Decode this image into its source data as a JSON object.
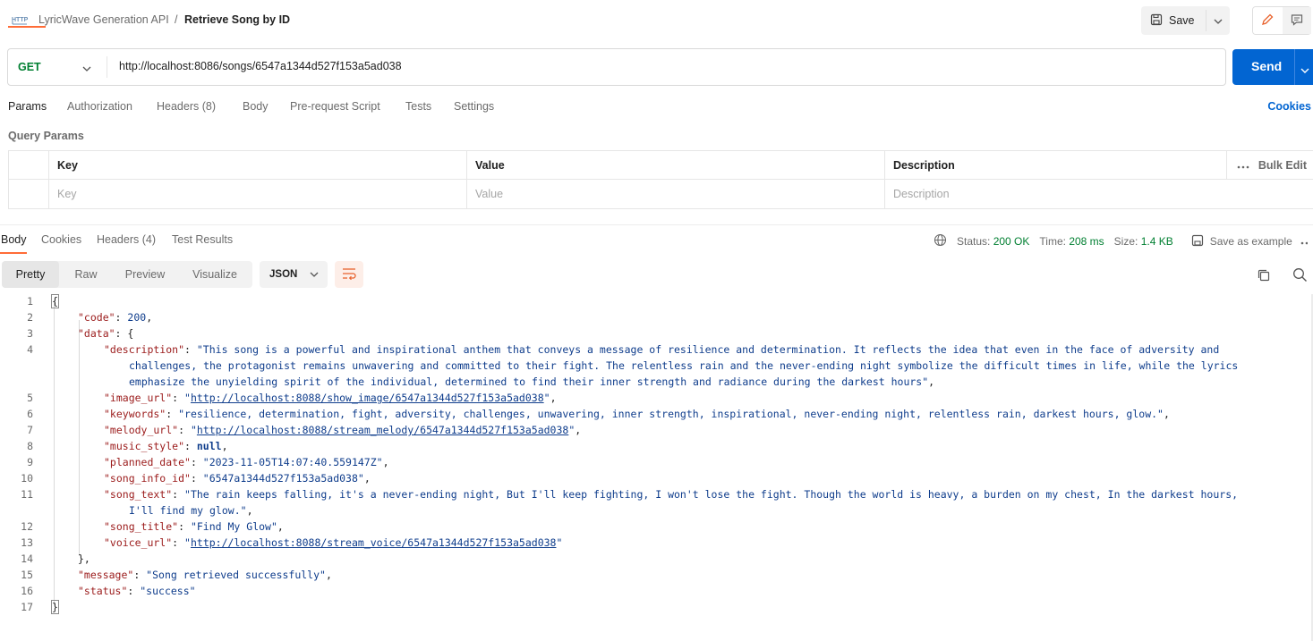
{
  "header": {
    "collection": "LyricWave Generation API",
    "separator": "/",
    "request_name": "Retrieve Song by ID",
    "save_label": "Save"
  },
  "request": {
    "method": "GET",
    "url": "http://localhost:8086/songs/6547a1344d527f153a5ad038",
    "send_label": "Send"
  },
  "request_tabs": [
    "Params",
    "Authorization",
    "Headers (8)",
    "Body",
    "Pre-request Script",
    "Tests",
    "Settings"
  ],
  "cookies_label": "Cookies",
  "query_params": {
    "title": "Query Params",
    "columns": [
      "Key",
      "Value",
      "Description"
    ],
    "bulk_edit": "Bulk Edit",
    "placeholders": [
      "Key",
      "Value",
      "Description"
    ]
  },
  "response": {
    "tabs": [
      "Body",
      "Cookies",
      "Headers (4)",
      "Test Results"
    ],
    "status_label": "Status:",
    "status_value": "200 OK",
    "time_label": "Time:",
    "time_value": "208 ms",
    "size_label": "Size:",
    "size_value": "1.4 KB",
    "save_example": "Save as example",
    "view_modes": [
      "Pretty",
      "Raw",
      "Preview",
      "Visualize"
    ],
    "format": "JSON"
  },
  "body": {
    "code": "200",
    "description_1": "\"This song is a powerful and inspirational anthem that conveys a message of resilience and determination. It reflects the idea that even in the face of adversity and",
    "description_2": "challenges, the protagonist remains unwavering and committed to their fight. The relentless rain and the never-ending night symbolize the difficult times in life, while the lyrics",
    "description_3": "emphasize the unyielding spirit of the individual, determined to find their inner strength and radiance during the darkest hours\"",
    "image_url": "http://localhost:8088/show_image/6547a1344d527f153a5ad038",
    "keywords": "\"resilience, determination, fight, adversity, challenges, unwavering, inner strength, inspirational, never-ending night, relentless rain, darkest hours, glow.\"",
    "melody_url": "http://localhost:8088/stream_melody/6547a1344d527f153a5ad038",
    "music_style": "null",
    "planned_date": "\"2023-11-05T14:07:40.559147Z\"",
    "song_info_id": "\"6547a1344d527f153a5ad038\"",
    "song_text_1": "\"The rain keeps falling, it's a never-ending night, But I'll keep fighting, I won't lose the fight. Though the world is heavy, a burden on my chest, In the darkest hours,",
    "song_text_2": "I'll find my glow.\"",
    "song_title": "\"Find My Glow\"",
    "voice_url": "http://localhost:8088/stream_voice/6547a1344d527f153a5ad038",
    "message": "\"Song retrieved successfully\"",
    "status": "\"success\""
  },
  "line_numbers": [
    "1",
    "2",
    "3",
    "4",
    "5",
    "6",
    "7",
    "8",
    "9",
    "10",
    "11",
    "12",
    "13",
    "14",
    "15",
    "16",
    "17"
  ]
}
